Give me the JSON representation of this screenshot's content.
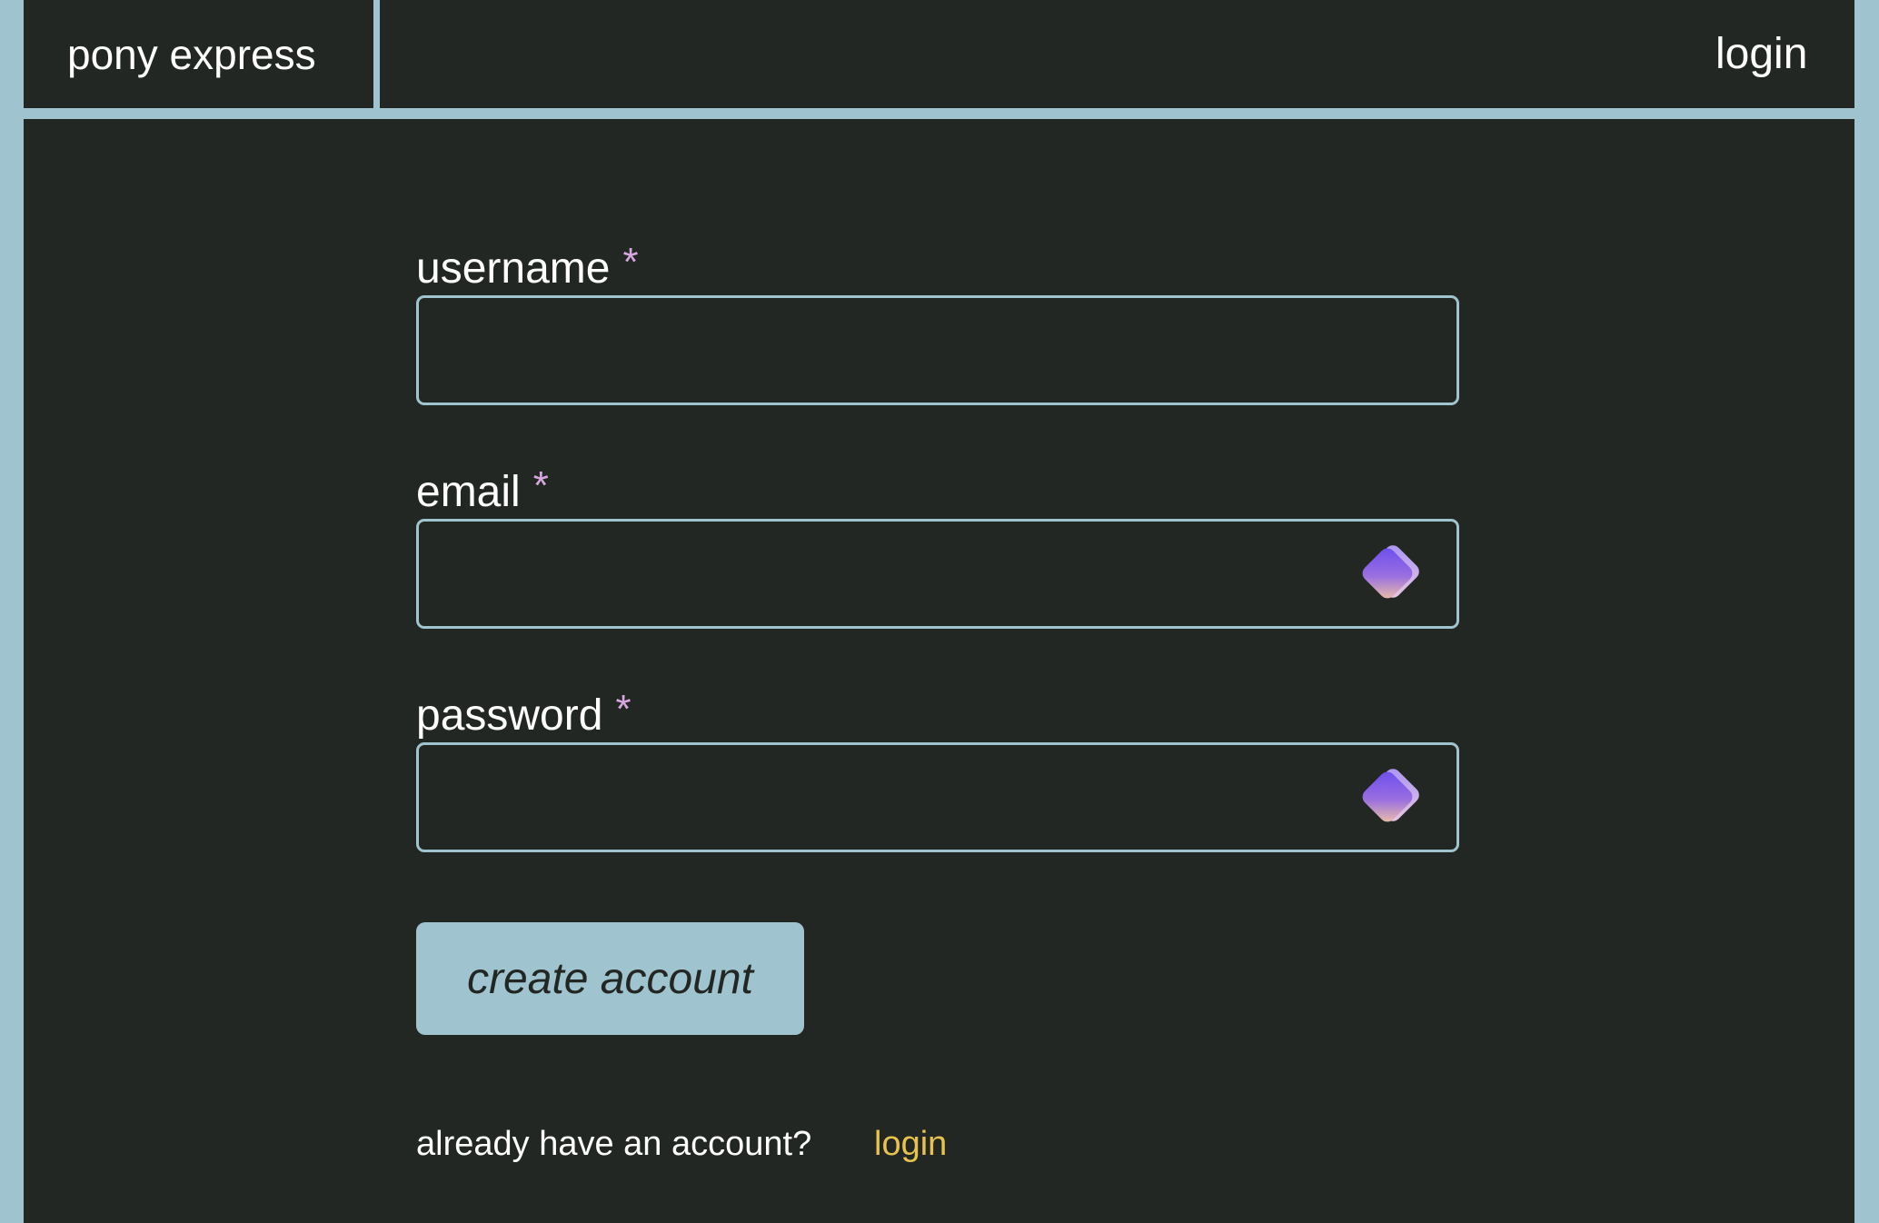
{
  "header": {
    "brand": "pony express",
    "login_link": "login"
  },
  "form": {
    "fields": [
      {
        "label": "username",
        "required_mark": "*",
        "value": "",
        "has_key_icon": false
      },
      {
        "label": "email",
        "required_mark": "*",
        "value": "",
        "has_key_icon": true,
        "icon": "password-manager-key-icon"
      },
      {
        "label": "password",
        "required_mark": "*",
        "value": "",
        "has_key_icon": true,
        "icon": "password-manager-key-icon"
      }
    ],
    "submit_label": "create account",
    "already_text": "already have an account?",
    "login_link": "login"
  },
  "colors": {
    "background": "#232723",
    "frame": "#a0c4cf",
    "accent_link": "#e6c24e",
    "required_mark": "#d8a6e0"
  }
}
